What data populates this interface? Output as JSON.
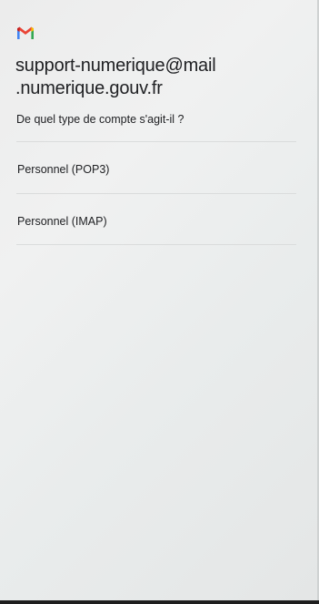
{
  "app": {
    "logo_icon": "gmail-logo-icon",
    "brand_colors": [
      "#4285f4",
      "#ea4335",
      "#fbbc05",
      "#34a853",
      "#c5221f"
    ]
  },
  "account": {
    "email_line1": "support-numerique@mail",
    "email_line2": ".numerique.gouv.fr"
  },
  "prompt": {
    "question": "De quel type de compte s'agit-il ?"
  },
  "options": [
    {
      "label": "Personnel (POP3)"
    },
    {
      "label": "Personnel (IMAP)"
    }
  ]
}
